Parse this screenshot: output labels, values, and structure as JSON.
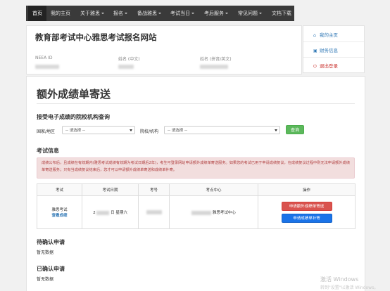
{
  "nav": {
    "items": [
      "首页",
      "我的主页",
      "关于雅思",
      "报名",
      "备战雅思",
      "考试当日",
      "考后服务",
      "常见问题",
      "文档下载"
    ],
    "active_index": 0
  },
  "header": {
    "site_title": "教育部考试中心雅思考试报名网站",
    "neea_label": "NEEA ID",
    "name_cn_label": "姓名 (中文)",
    "name_pinyin_label": "姓名 (拼音/英文)"
  },
  "side": {
    "home": "我的主页",
    "finance": "财务信息",
    "logout": "退出登录"
  },
  "main": {
    "page_title": "额外成绩单寄送",
    "query_title": "接受电子成绩的院校机构查询",
    "country_label": "国家/地区",
    "country_placeholder": "-- 请选择 --",
    "institution_label": "院校/机构",
    "institution_placeholder": "-- 请选择 --",
    "query_button": "查询",
    "exam_info_title": "考试信息",
    "alert_text": "成绩公布后，且成绩在有效期内(雅思考试成绩有效期为考试日期后2年)，考生可登录网站申请额外成绩单寄送服务。如果您的考试已用于申请成绩复议，在成绩复议过程中则无法申请额外成绩单寄送服务；只有当成绩复议结束后，您才可以申请额外成绩单寄送和成绩单补寄。",
    "table": {
      "headers": [
        "考试",
        "考试日期",
        "考号",
        "考点中心",
        "操作"
      ],
      "row": {
        "exam_name": "雅思考试",
        "exam_link": "查看成绩",
        "date_prefix": "2",
        "date_suffix": "日 星期六",
        "center_suffix": "雅思考试中心",
        "btn_send": "申请额外成绩单寄送",
        "btn_reissue": "申请成绩单补寄"
      }
    },
    "pending_title": "待确认申请",
    "pending_empty": "暂无数据",
    "confirmed_title": "已确认申请",
    "confirmed_empty": "暂无数据"
  },
  "watermark": {
    "line1": "激活 Windows",
    "line2": "转到\"设置\"以激活 Windows。"
  },
  "colors": {
    "nav_bg": "#3a3a3a",
    "link_blue": "#337ab7",
    "danger_red": "#d9534f",
    "success_green": "#5cb85c",
    "primary_blue": "#1a73e8",
    "alert_bg": "#f2dede"
  }
}
